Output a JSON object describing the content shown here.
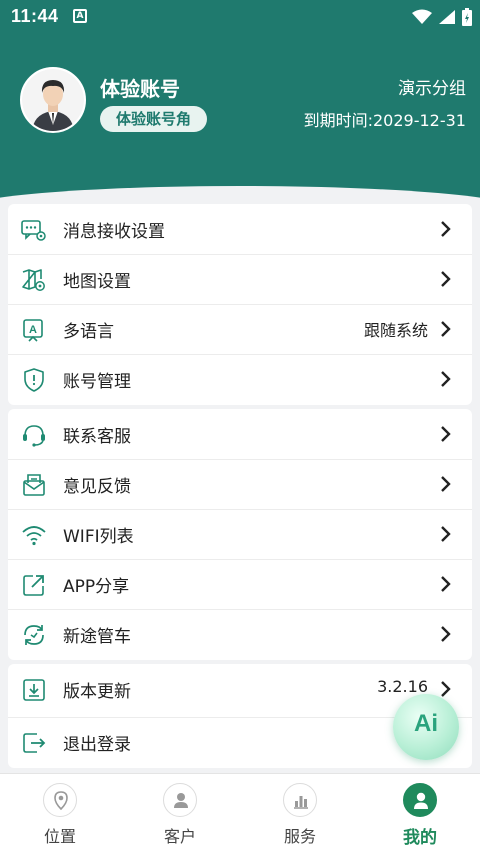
{
  "status_bar": {
    "time": "11:44",
    "notification_icon": "a-icon"
  },
  "profile": {
    "username": "体验账号",
    "role": "体验账号角",
    "group": "演示分组",
    "expire": "到期时间:2029-12-31"
  },
  "menu": {
    "section1": [
      {
        "label": "消息接收设置",
        "value": "",
        "icon": "message-settings-icon"
      },
      {
        "label": "地图设置",
        "value": "",
        "icon": "map-settings-icon"
      },
      {
        "label": "多语言",
        "value": "跟随系统",
        "icon": "language-icon"
      },
      {
        "label": "账号管理",
        "value": "",
        "icon": "account-shield-icon"
      }
    ],
    "section2": [
      {
        "label": "联系客服",
        "value": "",
        "icon": "headset-icon"
      },
      {
        "label": "意见反馈",
        "value": "",
        "icon": "feedback-mail-icon"
      },
      {
        "label": "WIFI列表",
        "value": "",
        "icon": "wifi-icon"
      },
      {
        "label": "APP分享",
        "value": "",
        "icon": "share-icon"
      },
      {
        "label": "新途管车",
        "value": "",
        "icon": "refresh-car-icon"
      }
    ],
    "section3": [
      {
        "label": "版本更新",
        "value": "3.2.16",
        "icon": "update-icon"
      },
      {
        "label": "退出登录",
        "value": "",
        "icon": "logout-icon"
      }
    ]
  },
  "ai_button": {
    "label": "Ai"
  },
  "bottom_nav": [
    {
      "label": "位置",
      "icon": "location-icon",
      "active": false
    },
    {
      "label": "客户",
      "icon": "customer-icon",
      "active": false
    },
    {
      "label": "服务",
      "icon": "service-chart-icon",
      "active": false
    },
    {
      "label": "我的",
      "icon": "profile-icon",
      "active": true
    }
  ],
  "colors": {
    "primary": "#1f7a6e",
    "nav_active": "#1f8a5c",
    "background": "#f1f2f4"
  }
}
